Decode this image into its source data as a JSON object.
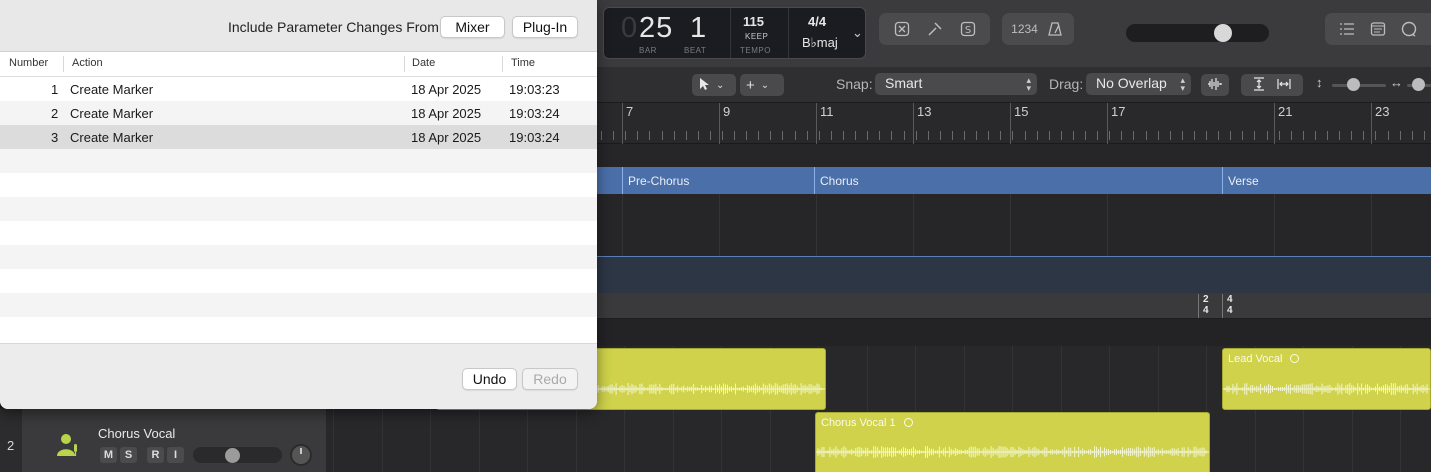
{
  "lcd": {
    "bar": "25",
    "bar_lead": "0",
    "beat": "1",
    "bar_label": "BAR",
    "beat_label": "BEAT",
    "tempo": "115",
    "keep_label": "KEEP",
    "tempo_label": "TEMPO",
    "time_sig": "4/4",
    "key": "B♭maj"
  },
  "control_bar": {
    "count_in": "1234"
  },
  "toolbar": {
    "snap_label": "Snap:",
    "snap_value": "Smart",
    "drag_label": "Drag:",
    "drag_value": "No Overlap"
  },
  "ruler": {
    "bars": [
      "7",
      "9",
      "11",
      "13",
      "15",
      "17",
      "21",
      "23"
    ]
  },
  "markers": [
    {
      "name": "Pre-Chorus"
    },
    {
      "name": "Chorus"
    },
    {
      "name": "Verse"
    }
  ],
  "signatures": [
    {
      "top": "2",
      "bottom": "4"
    },
    {
      "top": "4",
      "bottom": "4"
    }
  ],
  "regions": [
    {
      "name": ""
    },
    {
      "name": "Lead Vocal"
    },
    {
      "name": "Chorus Vocal 1"
    }
  ],
  "track": {
    "number": "2",
    "name": "Chorus Vocal",
    "mute": "M",
    "solo": "S",
    "record": "R",
    "input": "I"
  },
  "undo_panel": {
    "include_label": "Include Parameter Changes From:",
    "mixer_button": "Mixer",
    "plugin_button": "Plug-In",
    "columns": [
      "Number",
      "Action",
      "Date",
      "Time"
    ],
    "rows": [
      {
        "number": "1",
        "action": "Create Marker",
        "date": "18 Apr 2025",
        "time": "19:03:23"
      },
      {
        "number": "2",
        "action": "Create Marker",
        "date": "18 Apr 2025",
        "time": "19:03:24"
      },
      {
        "number": "3",
        "action": "Create Marker",
        "date": "18 Apr 2025",
        "time": "19:03:24"
      }
    ],
    "undo_button": "Undo",
    "redo_button": "Redo"
  }
}
